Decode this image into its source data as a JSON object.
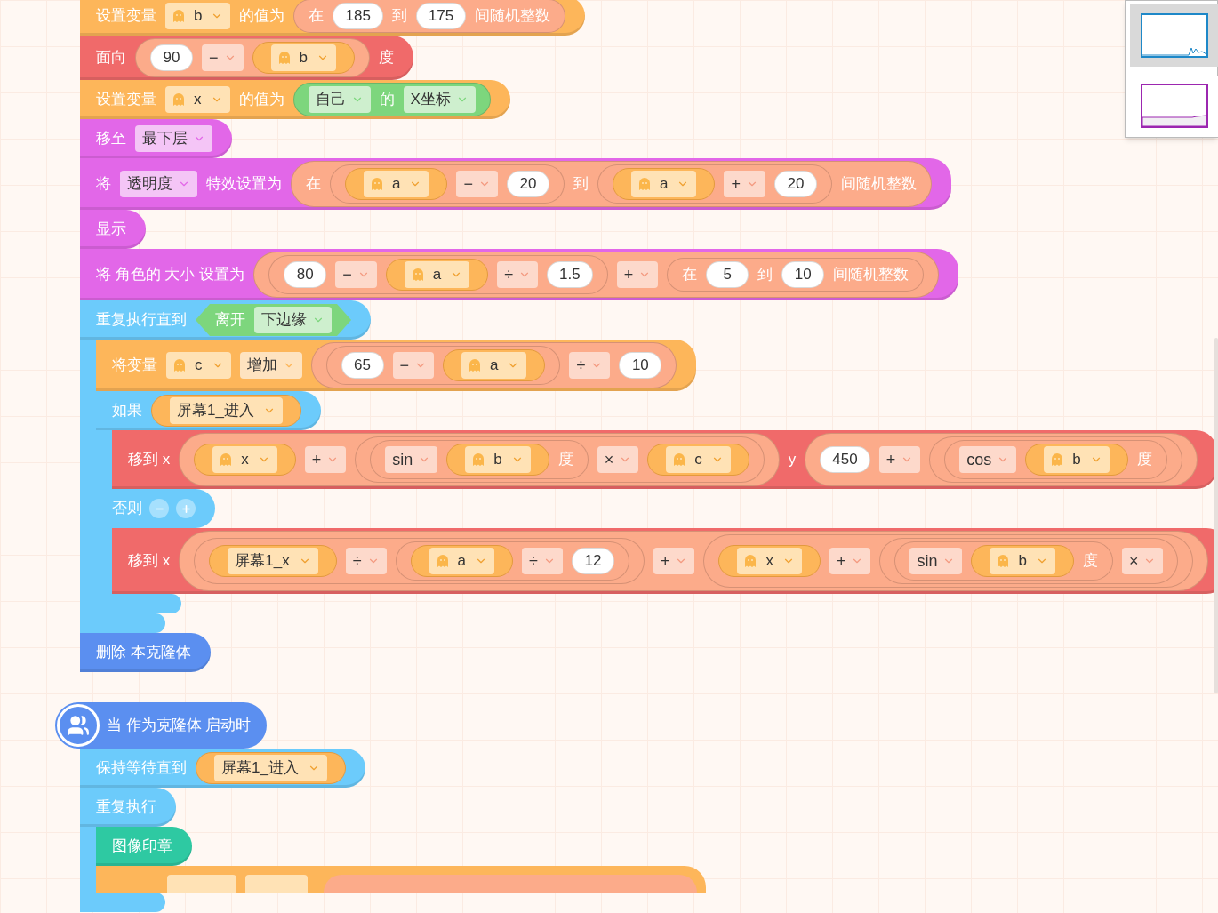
{
  "scripts": [
    {
      "blocks": [
        {
          "kind": "stack",
          "color": "#fdb65a",
          "parts": [
            {
              "kind": "text",
              "text": "设置变量"
            },
            {
              "kind": "var-field",
              "text": "b"
            },
            {
              "kind": "text",
              "text": "的值为"
            },
            {
              "kind": "reporter",
              "color": "#fcab8a",
              "parts": [
                {
                  "kind": "text",
                  "text": "在"
                },
                {
                  "kind": "number",
                  "text": "185"
                },
                {
                  "kind": "text",
                  "text": "到"
                },
                {
                  "kind": "number",
                  "text": "175"
                },
                {
                  "kind": "text",
                  "text": "间随机整数"
                }
              ]
            }
          ]
        },
        {
          "kind": "stack",
          "color": "#f06a6a",
          "parts": [
            {
              "kind": "text",
              "text": "面向"
            },
            {
              "kind": "reporter",
              "color": "#fcab8a",
              "parts": [
                {
                  "kind": "number",
                  "text": "90"
                },
                {
                  "kind": "op",
                  "text": "−"
                },
                {
                  "kind": "variable",
                  "text": "b"
                }
              ]
            },
            {
              "kind": "text",
              "text": "度"
            }
          ]
        },
        {
          "kind": "stack",
          "color": "#fdb65a",
          "parts": [
            {
              "kind": "text",
              "text": "设置变量"
            },
            {
              "kind": "var-field",
              "text": "x"
            },
            {
              "kind": "text",
              "text": "的值为"
            },
            {
              "kind": "reporter",
              "color": "#7dd67d",
              "parts": [
                {
                  "kind": "dropdown",
                  "text": "自己"
                },
                {
                  "kind": "text",
                  "text": "的"
                },
                {
                  "kind": "dropdown",
                  "text": "X坐标"
                }
              ]
            }
          ]
        },
        {
          "kind": "stack",
          "color": "#e267e8",
          "parts": [
            {
              "kind": "text",
              "text": "移至"
            },
            {
              "kind": "dropdown",
              "text": "最下层"
            }
          ]
        },
        {
          "kind": "stack",
          "color": "#e267e8",
          "parts": [
            {
              "kind": "text",
              "text": "将"
            },
            {
              "kind": "dropdown",
              "text": "透明度"
            },
            {
              "kind": "text",
              "text": "特效设置为"
            },
            {
              "kind": "reporter",
              "color": "#fcab8a",
              "parts": [
                {
                  "kind": "text",
                  "text": "在"
                },
                {
                  "kind": "reporter",
                  "color": "#fcab8a",
                  "parts": [
                    {
                      "kind": "variable",
                      "text": "a"
                    },
                    {
                      "kind": "op",
                      "text": "−"
                    },
                    {
                      "kind": "number",
                      "text": "20"
                    }
                  ]
                },
                {
                  "kind": "text",
                  "text": "到"
                },
                {
                  "kind": "reporter",
                  "color": "#fcab8a",
                  "parts": [
                    {
                      "kind": "variable",
                      "text": "a"
                    },
                    {
                      "kind": "op",
                      "text": "+"
                    },
                    {
                      "kind": "number",
                      "text": "20"
                    }
                  ]
                },
                {
                  "kind": "text",
                  "text": "间随机整数"
                }
              ]
            }
          ]
        },
        {
          "kind": "stack",
          "color": "#e267e8",
          "parts": [
            {
              "kind": "text",
              "text": "显示"
            }
          ]
        },
        {
          "kind": "stack",
          "color": "#e267e8",
          "parts": [
            {
              "kind": "text",
              "text": "将 角色的 大小 设置为"
            },
            {
              "kind": "reporter",
              "color": "#fcab8a",
              "parts": [
                {
                  "kind": "reporter",
                  "color": "#fcab8a",
                  "parts": [
                    {
                      "kind": "number",
                      "text": "80"
                    },
                    {
                      "kind": "op",
                      "text": "−"
                    },
                    {
                      "kind": "variable",
                      "text": "a"
                    },
                    {
                      "kind": "op",
                      "text": "÷"
                    },
                    {
                      "kind": "number",
                      "text": "1.5"
                    }
                  ]
                },
                {
                  "kind": "op",
                  "text": "+"
                },
                {
                  "kind": "reporter",
                  "color": "#fcab8a",
                  "parts": [
                    {
                      "kind": "text",
                      "text": "在"
                    },
                    {
                      "kind": "number",
                      "text": "5"
                    },
                    {
                      "kind": "text",
                      "text": "到"
                    },
                    {
                      "kind": "number",
                      "text": "10"
                    },
                    {
                      "kind": "text",
                      "text": "间随机整数"
                    }
                  ]
                }
              ]
            }
          ]
        },
        {
          "kind": "c",
          "color": "#6ccbfb",
          "parts": [
            {
              "kind": "text",
              "text": "重复执行直到"
            },
            {
              "kind": "boolean",
              "color": "#7dd67d",
              "parts": [
                {
                  "kind": "text",
                  "text": "离开"
                },
                {
                  "kind": "dropdown",
                  "text": "下边缘"
                }
              ]
            }
          ],
          "body": [
            {
              "kind": "stack",
              "color": "#fdb65a",
              "parts": [
                {
                  "kind": "text",
                  "text": "将变量"
                },
                {
                  "kind": "var-field",
                  "text": "c"
                },
                {
                  "kind": "dropdown",
                  "text": "增加"
                },
                {
                  "kind": "reporter",
                  "color": "#fcab8a",
                  "parts": [
                    {
                      "kind": "reporter",
                      "color": "#fcab8a",
                      "parts": [
                        {
                          "kind": "number",
                          "text": "65"
                        },
                        {
                          "kind": "op",
                          "text": "−"
                        },
                        {
                          "kind": "variable",
                          "text": "a"
                        }
                      ]
                    },
                    {
                      "kind": "op",
                      "text": "÷"
                    },
                    {
                      "kind": "number",
                      "text": "10"
                    }
                  ]
                }
              ]
            },
            {
              "kind": "if-else",
              "color": "#6ccbfb",
              "parts": [
                {
                  "kind": "text",
                  "text": "如果"
                },
                {
                  "kind": "global",
                  "text": "屏幕1_进入"
                }
              ],
              "body": [
                {
                  "kind": "stack",
                  "color": "#f06a6a",
                  "parts": [
                    {
                      "kind": "text",
                      "text": "移到 x"
                    },
                    {
                      "kind": "reporter",
                      "color": "#fcab8a",
                      "parts": [
                        {
                          "kind": "variable",
                          "text": "x"
                        },
                        {
                          "kind": "op",
                          "text": "+"
                        },
                        {
                          "kind": "reporter",
                          "color": "#fcab8a",
                          "parts": [
                            {
                              "kind": "reporter",
                              "color": "#fcab8a",
                              "parts": [
                                {
                                  "kind": "op",
                                  "text": "sin"
                                },
                                {
                                  "kind": "variable",
                                  "text": "b"
                                },
                                {
                                  "kind": "text",
                                  "text": "度"
                                }
                              ]
                            },
                            {
                              "kind": "op",
                              "text": "×"
                            },
                            {
                              "kind": "variable",
                              "text": "c"
                            }
                          ]
                        }
                      ]
                    },
                    {
                      "kind": "text",
                      "text": "y"
                    },
                    {
                      "kind": "reporter",
                      "color": "#fcab8a",
                      "parts": [
                        {
                          "kind": "number",
                          "text": "450"
                        },
                        {
                          "kind": "op",
                          "text": "+"
                        },
                        {
                          "kind": "reporter",
                          "color": "#fcab8a",
                          "parts": [
                            {
                              "kind": "reporter",
                              "color": "#fcab8a",
                              "parts": [
                                {
                                  "kind": "op",
                                  "text": "cos"
                                },
                                {
                                  "kind": "variable",
                                  "text": "b"
                                },
                                {
                                  "kind": "text",
                                  "text": "度"
                                }
                              ]
                            }
                          ]
                        }
                      ]
                    }
                  ]
                }
              ],
              "else_label": "否则",
              "else_body": [
                {
                  "kind": "stack",
                  "color": "#f06a6a",
                  "parts": [
                    {
                      "kind": "text",
                      "text": "移到 x"
                    },
                    {
                      "kind": "reporter",
                      "color": "#fcab8a",
                      "parts": [
                        {
                          "kind": "reporter",
                          "color": "#fcab8a",
                          "parts": [
                            {
                              "kind": "global",
                              "text": "屏幕1_x"
                            },
                            {
                              "kind": "op",
                              "text": "÷"
                            },
                            {
                              "kind": "reporter",
                              "color": "#fcab8a",
                              "parts": [
                                {
                                  "kind": "variable",
                                  "text": "a"
                                },
                                {
                                  "kind": "op",
                                  "text": "÷"
                                },
                                {
                                  "kind": "number",
                                  "text": "12"
                                }
                              ]
                            }
                          ]
                        },
                        {
                          "kind": "op",
                          "text": "+"
                        },
                        {
                          "kind": "reporter",
                          "color": "#fcab8a",
                          "parts": [
                            {
                              "kind": "variable",
                              "text": "x"
                            },
                            {
                              "kind": "op",
                              "text": "+"
                            },
                            {
                              "kind": "reporter",
                              "color": "#fcab8a",
                              "parts": [
                                {
                                  "kind": "reporter",
                                  "color": "#fcab8a",
                                  "parts": [
                                    {
                                      "kind": "op",
                                      "text": "sin"
                                    },
                                    {
                                      "kind": "variable",
                                      "text": "b"
                                    },
                                    {
                                      "kind": "text",
                                      "text": "度"
                                    }
                                  ]
                                },
                                {
                                  "kind": "op",
                                  "text": "×"
                                }
                              ]
                            }
                          ]
                        }
                      ]
                    }
                  ]
                }
              ]
            }
          ]
        },
        {
          "kind": "stack",
          "color": "#5b8ff0",
          "parts": [
            {
              "kind": "text",
              "text": "删除 本克隆体"
            }
          ]
        }
      ]
    },
    {
      "hat": {
        "color": "#5b8ff0",
        "text": "当 作为克隆体 启动时"
      },
      "blocks": [
        {
          "kind": "stack",
          "color": "#6ccbfb",
          "parts": [
            {
              "kind": "text",
              "text": "保持等待直到"
            },
            {
              "kind": "global",
              "text": "屏幕1_进入"
            }
          ]
        },
        {
          "kind": "c",
          "color": "#6ccbfb",
          "parts": [
            {
              "kind": "text",
              "text": "重复执行"
            }
          ],
          "body": [
            {
              "kind": "stack",
              "color": "#2ec9a2",
              "parts": [
                {
                  "kind": "text",
                  "text": "图像印章"
                }
              ]
            },
            {
              "kind": "cut-off",
              "color": "#fdb65a"
            }
          ]
        }
      ]
    }
  ],
  "minimap": {
    "thumbnails": [
      {
        "selected": true,
        "color": "#1e88c8"
      },
      {
        "selected": false,
        "color": "#9c27b0"
      }
    ]
  }
}
